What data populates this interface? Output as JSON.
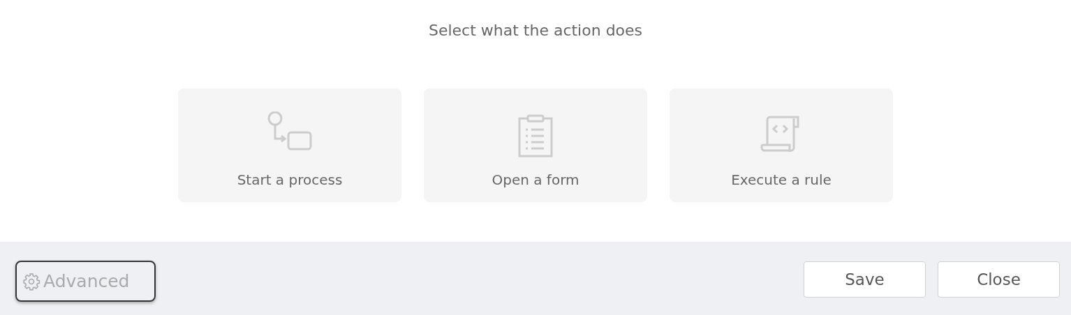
{
  "heading": "Select what the action does",
  "options": [
    {
      "kind": "process",
      "label": "Start a process"
    },
    {
      "kind": "form",
      "label": "Open a form"
    },
    {
      "kind": "rule",
      "label": "Execute a rule"
    }
  ],
  "footer": {
    "advanced": {
      "label": "Advanced",
      "focused": true
    },
    "buttons": [
      "Save",
      "Close"
    ]
  }
}
